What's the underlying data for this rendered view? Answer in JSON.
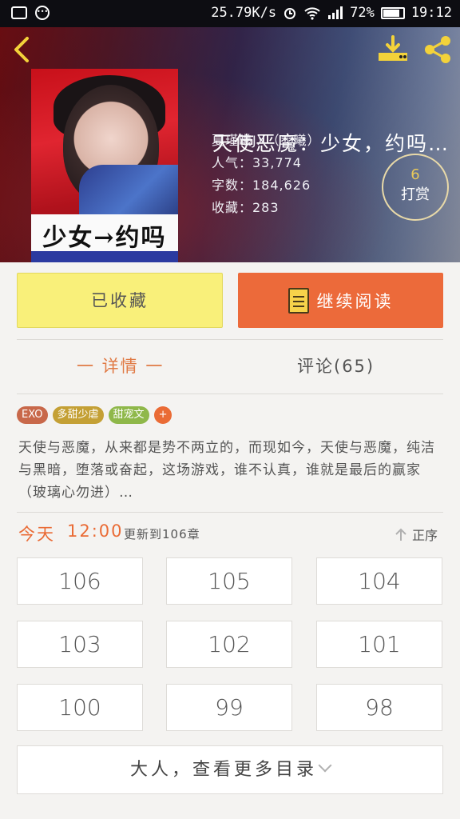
{
  "status_bar": {
    "speed": "25.79K/s",
    "battery": "72%",
    "time": "19:12"
  },
  "header": {
    "title": "天使恶魔：少女，约吗…",
    "author": "夏瑾曦JX（二曦）",
    "popularity": "人气：33,774",
    "word_count": "字数：184,626",
    "favorites": "收藏：283",
    "cover_text": "少女→约吗",
    "reward": {
      "count": "6",
      "label": "打赏"
    }
  },
  "actions": {
    "favorited": "已收藏",
    "continue_reading": "继续阅读"
  },
  "tabs": {
    "details": "一 详情 一",
    "comments": "评论(65)"
  },
  "tags": [
    {
      "label": "EXO",
      "color": "#c8684a"
    },
    {
      "label": "多甜少虐",
      "color": "#c4a035"
    },
    {
      "label": "甜宠文",
      "color": "#8fb84a"
    },
    {
      "label": "+",
      "color": "#ea6b35"
    }
  ],
  "description": "天使与恶魔，从来都是势不两立的，而现如今，天使与恶魔，纯洁与黑暗，堕落或奋起，这场游戏，谁不认真，谁就是最后的赢家（玻璃心勿进）…",
  "update": {
    "day": "今天",
    "time": "12:00",
    "text": "更新到106章",
    "sort": "正序"
  },
  "chapters": [
    "106",
    "105",
    "104",
    "103",
    "102",
    "101",
    "100",
    "99",
    "98"
  ],
  "more_catalog": "大人，查看更多目录"
}
